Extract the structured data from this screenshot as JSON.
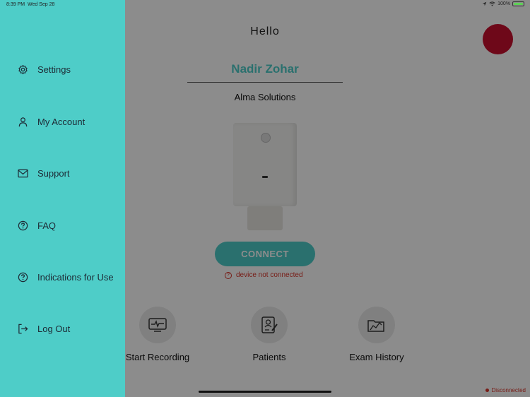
{
  "status_bar": {
    "time": "8:39 PM",
    "date": "Wed Sep 28",
    "battery": "100%"
  },
  "main": {
    "greeting": "Hello",
    "user_name": "Nadir Zohar",
    "company": "Alma Solutions",
    "connect_label": "CONNECT",
    "connection_status": "device not connected",
    "actions": [
      {
        "label": "Start Recording",
        "icon": "monitor-waveform-icon"
      },
      {
        "label": "Patients",
        "icon": "patient-clipboard-icon"
      },
      {
        "label": "Exam History",
        "icon": "folder-chart-icon"
      }
    ],
    "footer_status": "Disconnected"
  },
  "drawer": {
    "items": [
      {
        "label": "Settings",
        "icon": "gear-icon"
      },
      {
        "label": "My Account",
        "icon": "user-icon"
      },
      {
        "label": "Support",
        "icon": "mail-icon"
      },
      {
        "label": "FAQ",
        "icon": "question-circle-icon"
      },
      {
        "label": "Indications for Use",
        "icon": "question-circle-icon"
      },
      {
        "label": "Log Out",
        "icon": "logout-icon"
      }
    ]
  },
  "colors": {
    "accent": "#4ecdc8",
    "avatar": "#c8102e",
    "error": "#d9362b",
    "overlay": "rgba(0,0,0,0.45)"
  }
}
